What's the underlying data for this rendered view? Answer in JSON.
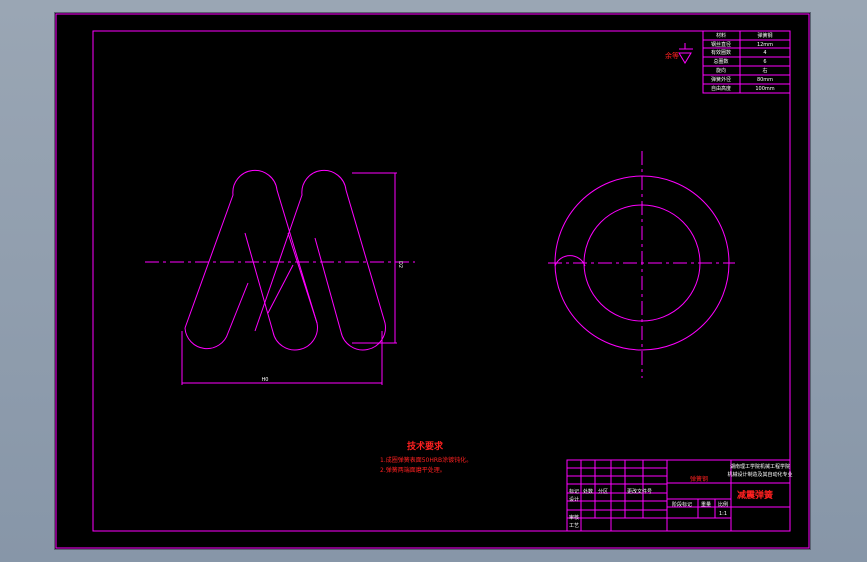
{
  "colors": {
    "line": "#ff00ff",
    "text_red": "#ff2020",
    "text_white": "#ffffff",
    "background": "#000000"
  },
  "drawing": {
    "roughness_label": "余等",
    "dimension_length": "H0",
    "dimension_diameter": "D2",
    "notes": {
      "title": "技术要求",
      "line1": "1.成圈弹簧表面50HRB涂镀钝化。",
      "line2": "2.弹簧两端面磨平处理。"
    }
  },
  "spec_table": {
    "rows": [
      {
        "label": "材料",
        "value": "弹簧钢"
      },
      {
        "label": "钢丝直径",
        "value": "12mm"
      },
      {
        "label": "有效圈数",
        "value": "4"
      },
      {
        "label": "总圈数",
        "value": "6"
      },
      {
        "label": "旋向",
        "value": "右"
      },
      {
        "label": "弹簧外径",
        "value": "80mm"
      },
      {
        "label": "自由高度",
        "value": "100mm"
      }
    ]
  },
  "title_block": {
    "material_cell": "弹簧钢",
    "school": "湖南理工学院机械工程学院",
    "school_line2": "机械设计制造及其自动化专业",
    "part_name": "减震弹簧",
    "row_labels": {
      "mark": "标记",
      "count": "处数",
      "zone": "分区",
      "change_doc": "更改文件号",
      "design": "设计",
      "review": "审核",
      "process": "工艺",
      "stage_mark": "阶段标记",
      "weight": "重量",
      "scale": "比例",
      "scale_value": "1:1"
    }
  }
}
